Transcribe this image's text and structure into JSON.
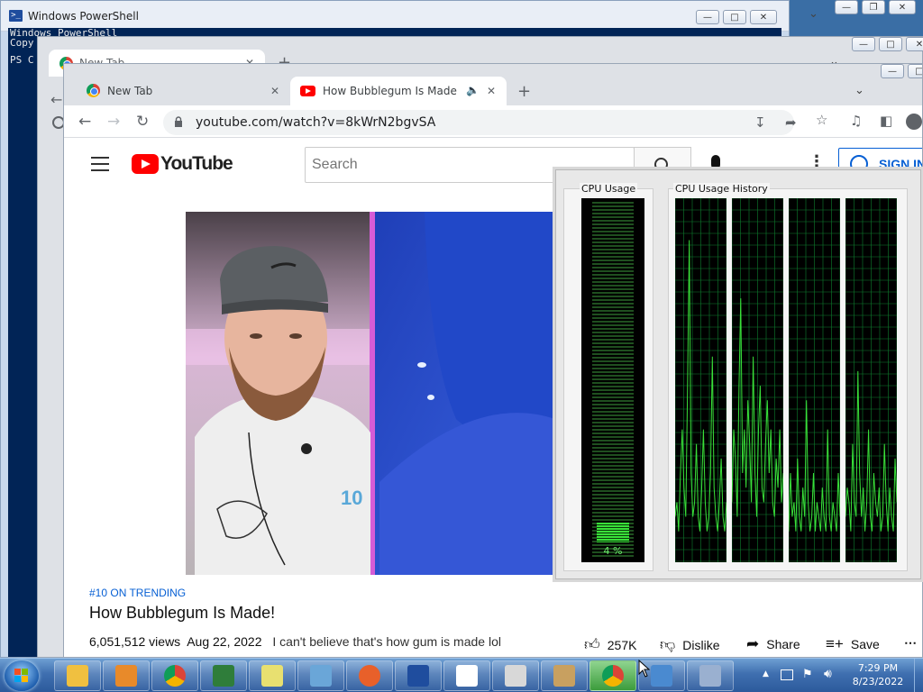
{
  "powershell": {
    "title": "Windows PowerShell",
    "icon": "powershell-icon",
    "console_lines": [
      "Windows PowerShell",
      "Copy",
      "",
      "PS C"
    ]
  },
  "chrome_back": {
    "tab_label": "New Tab"
  },
  "chrome": {
    "tabs": [
      {
        "label": "New Tab",
        "icon": "chrome-icon"
      },
      {
        "label": "How Bubblegum Is Made! - Y",
        "icon": "youtube-icon"
      }
    ],
    "url": "youtube.com/watch?v=8kWrN2bgvSA"
  },
  "youtube": {
    "logo_text": "YouTube",
    "search_placeholder": "Search",
    "sign_in": "SIGN IN",
    "trending": "#10 ON TRENDING",
    "title": "How Bubblegum Is Made!",
    "views": "6,051,512 views",
    "date": "Aug 22, 2022",
    "description": "I can't believe that's how gum is made lol",
    "likes": "257K",
    "dislike": "Dislike",
    "share": "Share",
    "save": "Save"
  },
  "cpu_meter": {
    "usage_label": "CPU Usage",
    "history_label": "CPU Usage History",
    "percent_text": "4 %",
    "percent_value": 4,
    "history_series": [
      [
        3,
        4,
        2,
        6,
        9,
        5,
        3,
        12,
        22,
        6,
        3,
        4,
        8,
        3,
        2,
        5,
        9,
        4,
        2,
        3,
        6,
        14,
        5,
        3,
        2,
        4,
        7,
        3,
        2,
        4
      ],
      [
        4,
        9,
        7,
        3,
        12,
        18,
        6,
        9,
        5,
        11,
        8,
        4,
        14,
        6,
        3,
        9,
        12,
        5,
        4,
        8,
        11,
        6,
        9,
        4,
        3,
        7,
        5,
        9,
        4,
        6
      ],
      [
        2,
        6,
        3,
        4,
        2,
        7,
        3,
        2,
        5,
        3,
        11,
        4,
        2,
        3,
        6,
        2,
        4,
        3,
        2,
        5,
        3,
        2,
        9,
        3,
        2,
        4,
        3,
        2,
        6,
        3
      ],
      [
        3,
        5,
        4,
        2,
        8,
        4,
        3,
        13,
        6,
        3,
        5,
        2,
        4,
        9,
        3,
        2,
        6,
        4,
        3,
        5,
        2,
        3,
        8,
        4,
        2,
        5,
        3,
        2,
        7,
        4
      ]
    ],
    "line_color": "#39e039",
    "grid_color": "#0f7f2f"
  },
  "taskbar": {
    "time": "7:29 PM",
    "date": "8/23/2022",
    "apps": [
      "explorer-icon",
      "media-player-icon",
      "chrome-icon",
      "task-manager-icon",
      "sticky-notes-icon",
      "notepad-icon",
      "firefox-icon",
      "powershell-icon",
      "xeyes-icon",
      "solitaire-icon",
      "paint-icon",
      "chrome-icon",
      "control-panel-icon",
      "on-screen-keyboard-icon"
    ]
  }
}
